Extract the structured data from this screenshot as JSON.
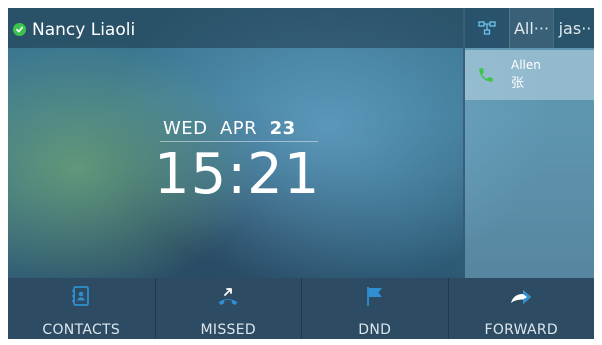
{
  "status_bar": {
    "user_name": "Nancy Liaoli",
    "status_color": "#3cc44d"
  },
  "right_panel": {
    "tabs": [
      {
        "icon": "blf-network-icon"
      },
      {
        "label": "All···"
      },
      {
        "label": "jas··"
      }
    ],
    "contact": {
      "first_name": "Allen",
      "last_name": "张",
      "icon": "phone-icon",
      "icon_color": "#3cc44d"
    }
  },
  "clock": {
    "weekday": "WED",
    "month": "APR",
    "day": "23",
    "time": "15:21"
  },
  "softkeys": [
    {
      "label": "CONTACTS",
      "icon": "contacts-book-icon"
    },
    {
      "label": "MISSED",
      "icon": "missed-call-icon"
    },
    {
      "label": "DND",
      "icon": "dnd-flag-icon"
    },
    {
      "label": "FORWARD",
      "icon": "forward-arrow-icon"
    }
  ],
  "colors": {
    "accent_blue": "#2f8fd0",
    "softkey_bar": "#2d4b62"
  }
}
